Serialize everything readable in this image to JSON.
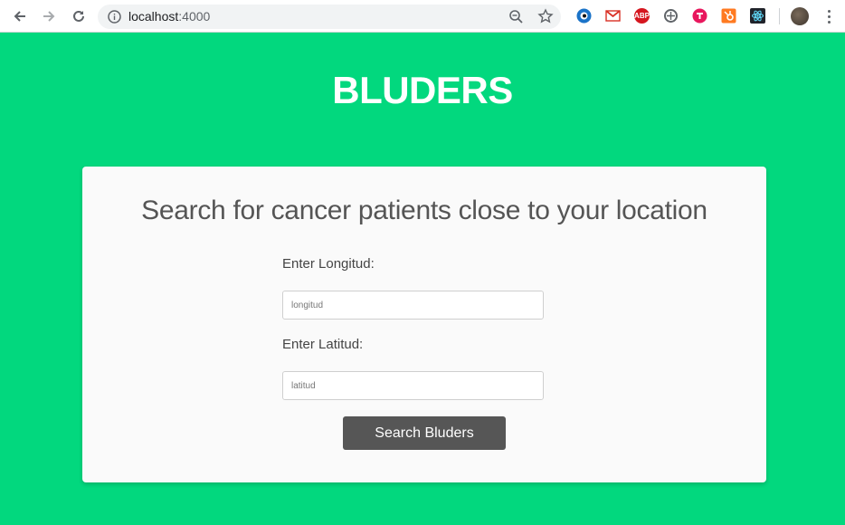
{
  "browser": {
    "url_host": "localhost",
    "url_port": ":4000"
  },
  "page": {
    "site_title": "BLUDERS",
    "heading": "Search for cancer patients close to your location",
    "longitude_label": "Enter Longitud:",
    "longitude_placeholder": "longitud",
    "latitude_label": "Enter Latitud:",
    "latitude_placeholder": "latitud",
    "search_button": "Search Bluders"
  },
  "extensions": {
    "adblock_text": "ABP"
  },
  "colors": {
    "background": "#02d87e",
    "card": "#fafafa",
    "button": "#565656"
  },
  "icons": [
    "back-arrow-icon",
    "forward-arrow-icon",
    "reload-icon",
    "info-icon",
    "zoom-icon",
    "star-icon",
    "menu-icon"
  ]
}
